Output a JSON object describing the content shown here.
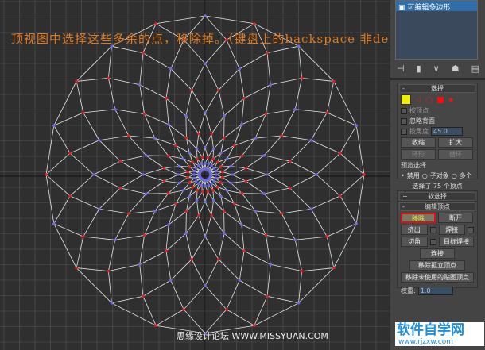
{
  "viewport": {
    "instruction": "顶视图中选择这些多余的点，移除掉。（键盘上的backspace 非delete）",
    "watermark": "思缘设计论坛 WWW.MISSYUAN.COM",
    "colors": {
      "edge": "#e6e6e6",
      "vertex": "#6a6ae8",
      "selected_vertex": "#e02020",
      "grid": "#555555"
    }
  },
  "panel": {
    "modifier_stack": [
      "可编辑多边形"
    ],
    "stack_icons": [
      "pin-icon",
      "show-end-result-icon",
      "make-unique-icon",
      "remove-modifier-icon",
      "configure-icon"
    ],
    "selection": {
      "title": "选择",
      "ignore_backfacing": "忽略背面",
      "by_vertex": "按顶点",
      "by_angle": "按角度",
      "angle": "45.0",
      "shrink": "收缩",
      "grow": "扩大",
      "ring": "环形",
      "loop": "循环",
      "preview_label": "预览选择",
      "preview_options": [
        "禁用",
        "子对象",
        "多个"
      ],
      "status": "选择了 75 个顶点"
    },
    "soft_selection": {
      "title": "软选择"
    },
    "edit_vertices": {
      "title": "编辑顶点",
      "remove": "移除",
      "break": "断开",
      "extrude": "挤出",
      "weld": "焊接",
      "chamfer": "切角",
      "target_weld": "目标焊接",
      "connect": "连接",
      "remove_isolated": "移除孤立顶点",
      "remove_unused_map": "移除未使用的贴图顶点",
      "weight_label": "权重:",
      "weight": "1.0"
    }
  },
  "logo": {
    "text": "软件自学网",
    "url": "www.rjzxw.com"
  }
}
